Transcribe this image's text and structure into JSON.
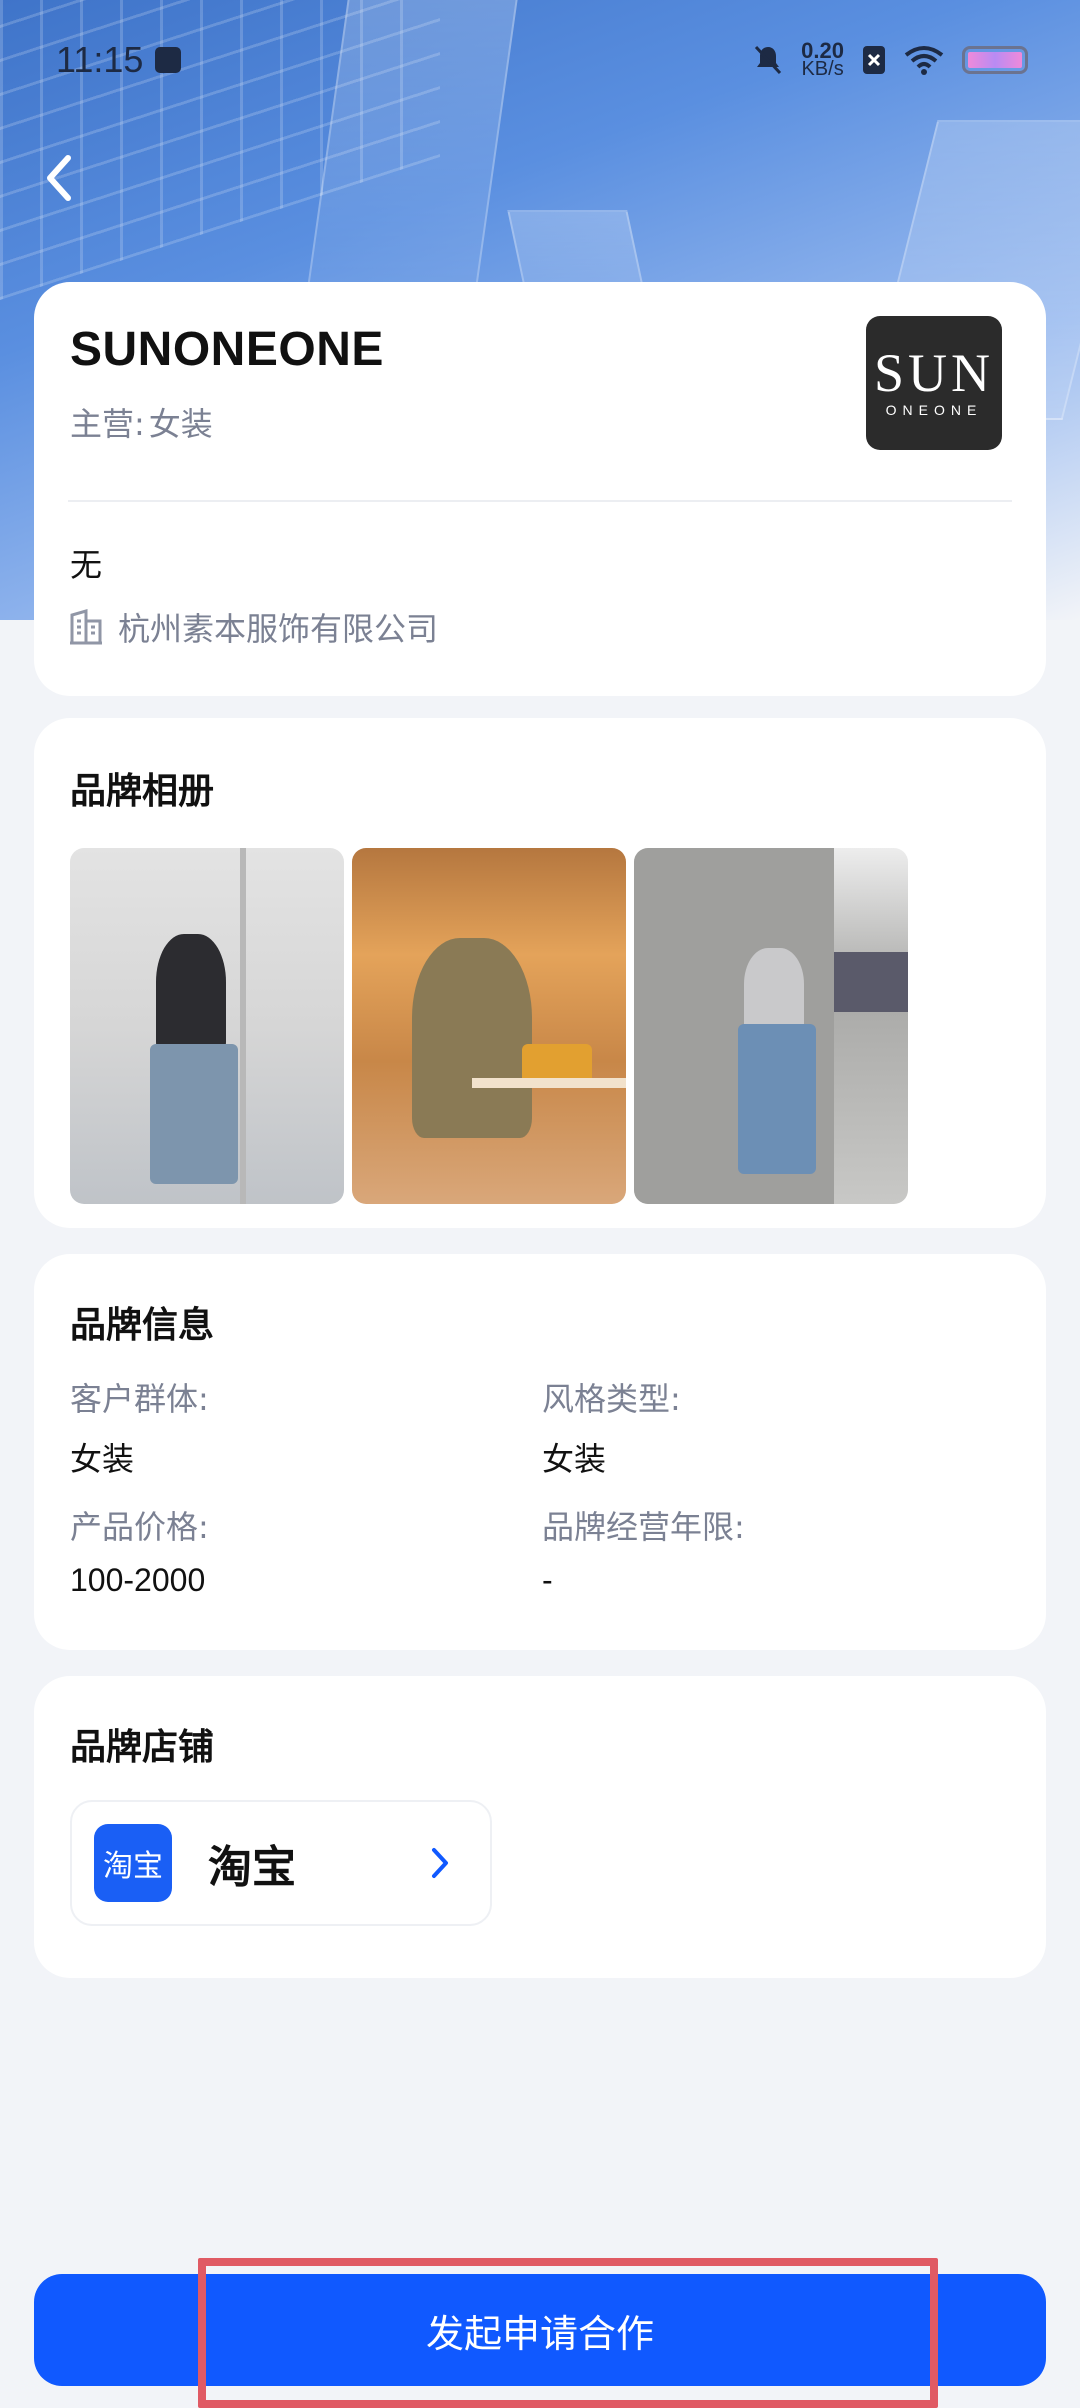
{
  "status_bar": {
    "time": "11:15",
    "net_speed_value": "0.20",
    "net_speed_unit": "KB/s"
  },
  "brand": {
    "name": "SUNONEONE",
    "main_label": "主营:",
    "main_value": "女装",
    "logo_line1": "SUN",
    "logo_line2": "ONEONE",
    "description": "无",
    "company": "杭州素本服饰有限公司"
  },
  "album": {
    "title": "品牌相册",
    "photo_count": 3
  },
  "info": {
    "title": "品牌信息",
    "fields": [
      {
        "label": "客户群体:",
        "value": "女装"
      },
      {
        "label": "风格类型:",
        "value": "女装"
      },
      {
        "label": "产品价格:",
        "value": "100-2000"
      },
      {
        "label": "品牌经营年限:",
        "value": "-"
      }
    ]
  },
  "stores": {
    "title": "品牌店铺",
    "items": [
      {
        "icon_text": "淘宝",
        "name": "淘宝",
        "icon": "taobao-icon"
      }
    ]
  },
  "cta": {
    "label": "发起申请合作"
  },
  "colors": {
    "accent": "#1059ff",
    "highlight": "#e05a64"
  }
}
